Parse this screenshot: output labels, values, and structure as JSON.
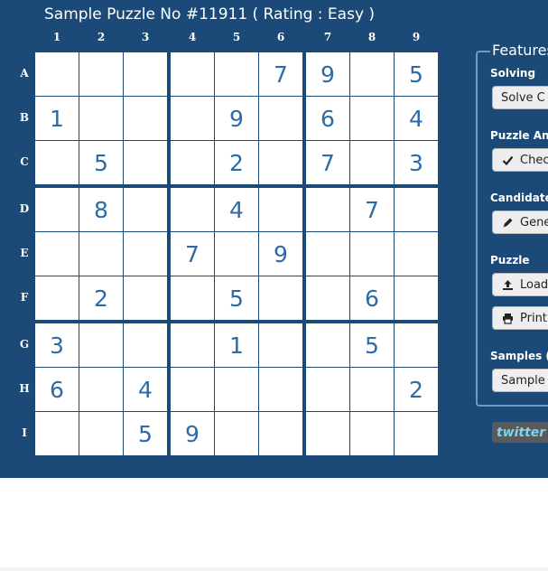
{
  "puzzle": {
    "title": "Sample Puzzle No #11911 ( Rating : Easy )",
    "columns": [
      "1",
      "2",
      "3",
      "4",
      "5",
      "6",
      "7",
      "8",
      "9"
    ],
    "rows": [
      "A",
      "B",
      "C",
      "D",
      "E",
      "F",
      "G",
      "H",
      "I"
    ],
    "grid": [
      [
        "",
        "",
        "",
        "",
        "",
        "7",
        "9",
        "",
        "5"
      ],
      [
        "1",
        "",
        "",
        "",
        "9",
        "",
        "6",
        "",
        "4"
      ],
      [
        "",
        "5",
        "",
        "",
        "2",
        "",
        "7",
        "",
        "3"
      ],
      [
        "",
        "8",
        "",
        "",
        "4",
        "",
        "",
        "7",
        ""
      ],
      [
        "",
        "",
        "",
        "7",
        "",
        "9",
        "",
        "",
        ""
      ],
      [
        "",
        "2",
        "",
        "",
        "5",
        "",
        "",
        "6",
        ""
      ],
      [
        "3",
        "",
        "",
        "",
        "1",
        "",
        "",
        "5",
        ""
      ],
      [
        "6",
        "",
        "4",
        "",
        "",
        "",
        "",
        "",
        "2"
      ],
      [
        "",
        "",
        "5",
        "9",
        "",
        "",
        "",
        "",
        ""
      ]
    ]
  },
  "features": {
    "legend": "Features",
    "solving": {
      "label": "Solving",
      "button": "Solve C"
    },
    "analysis": {
      "label": "Puzzle Ana",
      "button": "Chec"
    },
    "candidates": {
      "label": "Candidates",
      "button": "Gene"
    },
    "puzzle": {
      "label": "Puzzle",
      "load_button": "Load",
      "print_button": "Print"
    },
    "samples": {
      "label": "Samples (",
      "button": "Sample"
    }
  },
  "social": {
    "twitter": "twitter"
  },
  "colors": {
    "panel_bg": "#1b4a78",
    "digit": "#2d6aa6",
    "cell_bg": "#ffffff",
    "button_bg": "#eeeeee"
  }
}
